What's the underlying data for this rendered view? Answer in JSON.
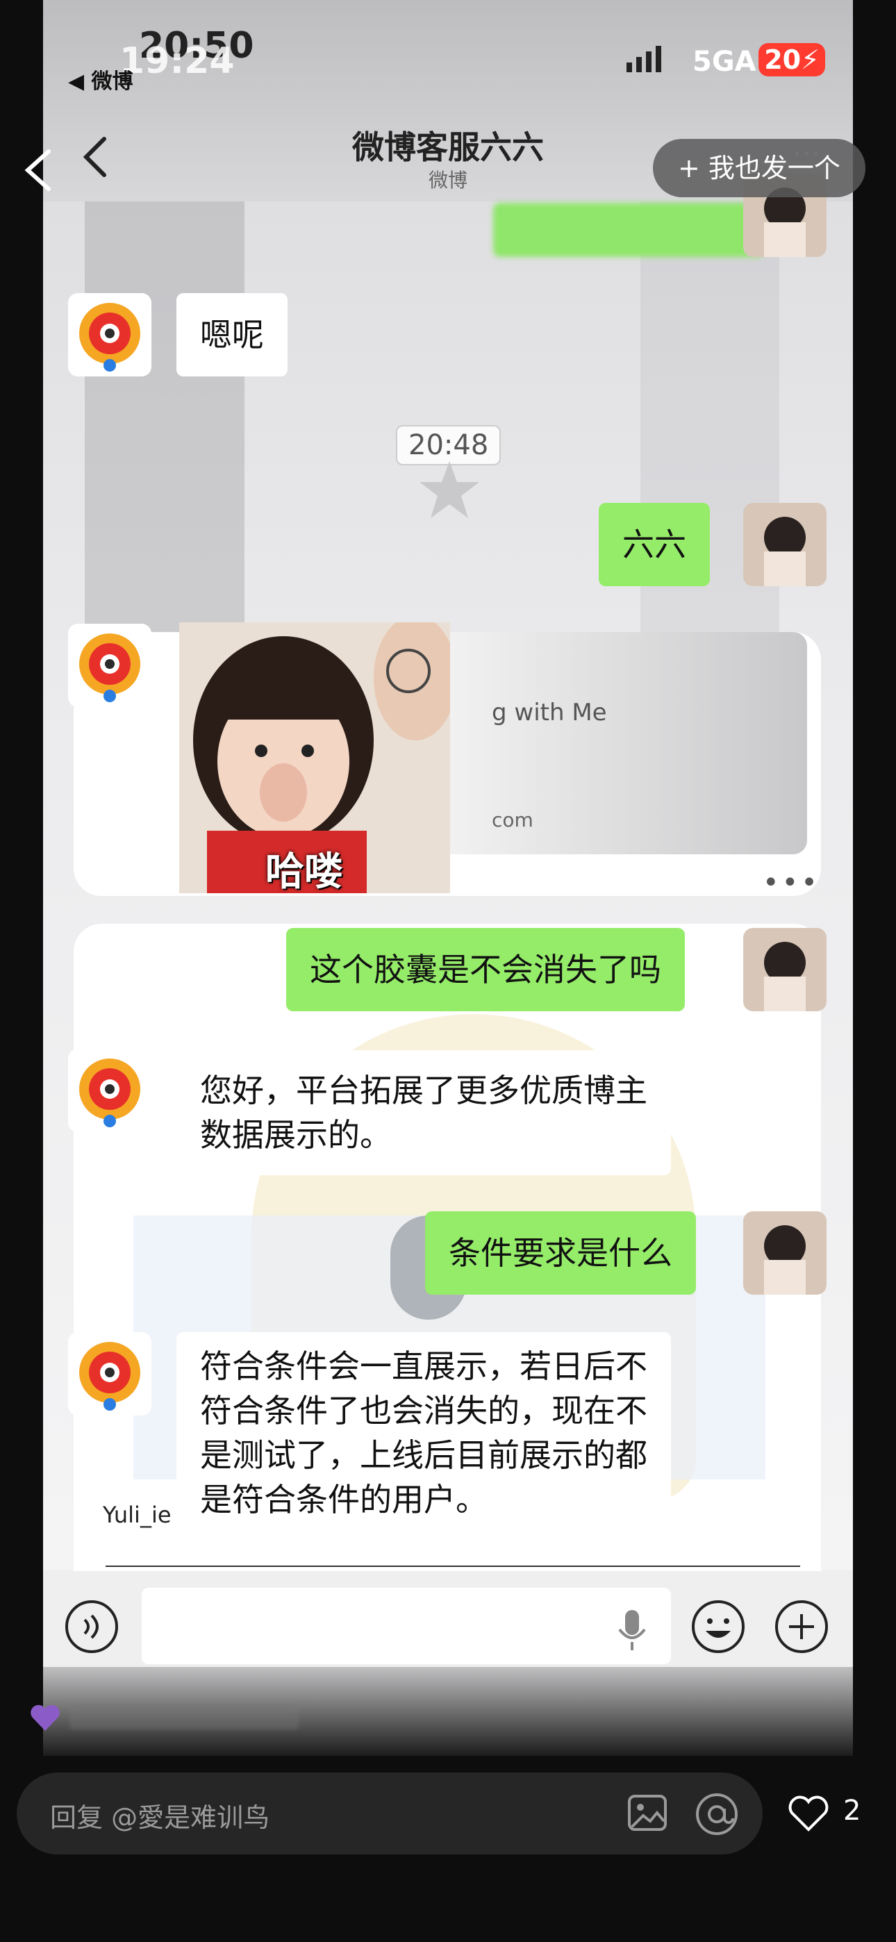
{
  "status_bar": {
    "time_back": "20:50",
    "time_front": "19:24",
    "back_app": "◀ 微博",
    "network": "5GA",
    "battery": "20"
  },
  "chat_header": {
    "title": "微博客服六六",
    "subtitle": "微博",
    "more": "···"
  },
  "action_button": {
    "label": "+ 我也发一个"
  },
  "messages": [
    {
      "side": "left",
      "text": "嗯呢"
    },
    {
      "side": "right",
      "text": "六六"
    },
    {
      "side": "right",
      "text": "这个胶囊是不会消失了吗"
    },
    {
      "side": "left",
      "text": "您好，平台拓展了更多优质博主\n数据展示的。"
    },
    {
      "side": "right",
      "text": "条件要求是什么"
    },
    {
      "side": "left",
      "text": "符合条件会一直展示，若日后不\n符合条件了也会消失的，现在不\n是测试了，上线后目前展示的都\n是符合条件的用户。"
    }
  ],
  "timestamp": "20:48",
  "sticker": {
    "caption": "哈喽"
  },
  "card_text": {
    "line1": "g with Me",
    "line2": "com",
    "more": "•••"
  },
  "username_fragment": "Yuli_ie",
  "comment_bar": {
    "placeholder": "回复 @愛是难训鸟",
    "like_count": "2"
  },
  "colors": {
    "green_bubble": "#95ec69",
    "background": "#0d0d0d",
    "input_bar": "#262626"
  }
}
